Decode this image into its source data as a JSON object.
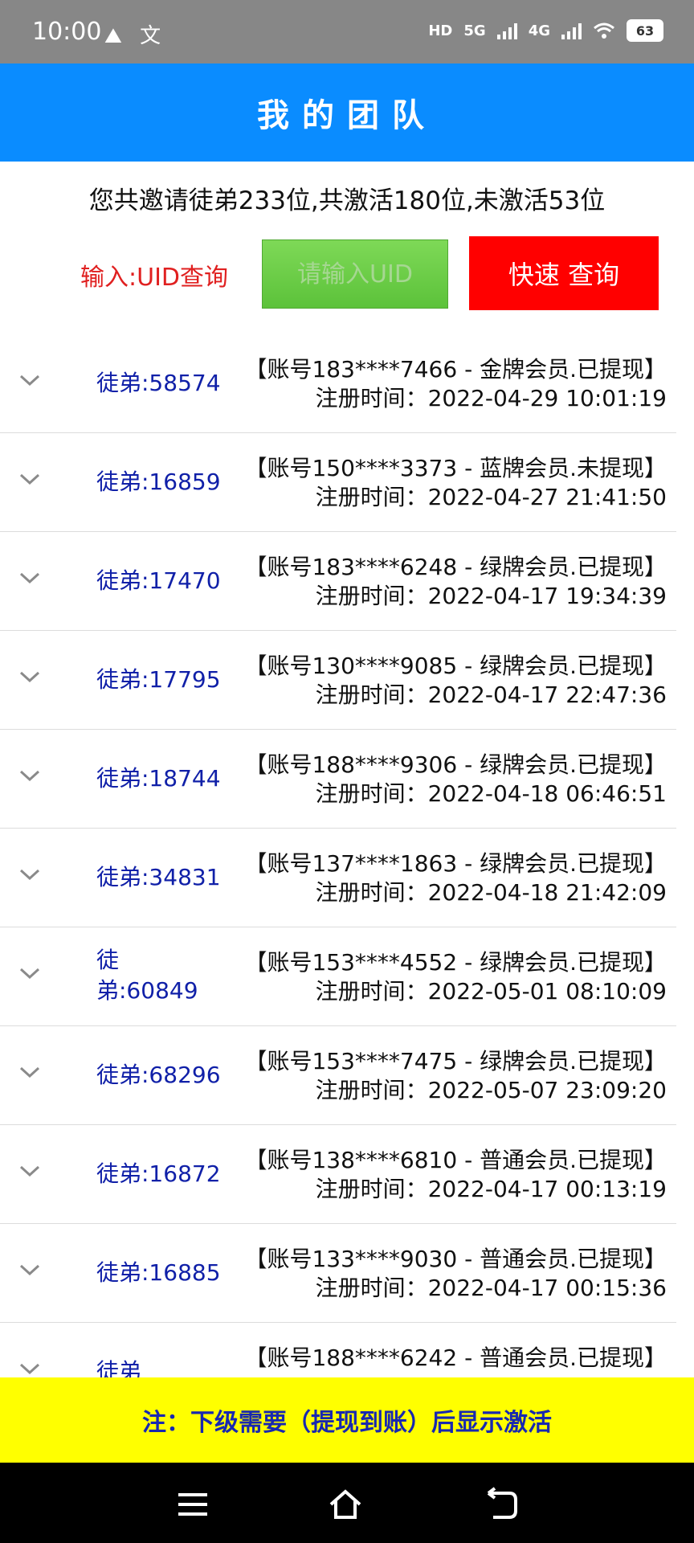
{
  "status": {
    "time": "10:00",
    "app_icons": [
      "mountain-app-icon",
      "text-app-icon"
    ],
    "indicators": {
      "hd": "HD",
      "net1": "5G",
      "net2": "4G",
      "battery": "63"
    }
  },
  "header": {
    "title": "我的团队"
  },
  "summary": "您共邀请徒弟233位,共激活180位,未激活53位",
  "query": {
    "label": "输入:UID查询",
    "placeholder": "请输入UID",
    "button": "快速 查询"
  },
  "members": [
    {
      "disciple": "徒弟:58574",
      "account": "【账号183****7466 - 金牌会员.已提现】",
      "reg": "注册时间：2022-04-29 10:01:19"
    },
    {
      "disciple": "徒弟:16859",
      "account": "【账号150****3373 - 蓝牌会员.未提现】",
      "reg": "注册时间：2022-04-27 21:41:50"
    },
    {
      "disciple": "徒弟:17470",
      "account": "【账号183****6248 - 绿牌会员.已提现】",
      "reg": "注册时间：2022-04-17 19:34:39"
    },
    {
      "disciple": "徒弟:17795",
      "account": "【账号130****9085 - 绿牌会员.已提现】",
      "reg": "注册时间：2022-04-17 22:47:36"
    },
    {
      "disciple": "徒弟:18744",
      "account": "【账号188****9306 - 绿牌会员.已提现】",
      "reg": "注册时间：2022-04-18 06:46:51"
    },
    {
      "disciple": "徒弟:34831",
      "account": "【账号137****1863 - 绿牌会员.已提现】",
      "reg": "注册时间：2022-04-18 21:42:09"
    },
    {
      "disciple": "徒弟:60849",
      "account": "【账号153****4552 - 绿牌会员.已提现】",
      "reg": "注册时间：2022-05-01 08:10:09"
    },
    {
      "disciple": "徒弟:68296",
      "account": "【账号153****7475 - 绿牌会员.已提现】",
      "reg": "注册时间：2022-05-07 23:09:20"
    },
    {
      "disciple": "徒弟:16872",
      "account": "【账号138****6810 - 普通会员.已提现】",
      "reg": "注册时间：2022-04-17 00:13:19"
    },
    {
      "disciple": "徒弟:16885",
      "account": "【账号133****9030 - 普通会员.已提现】",
      "reg": "注册时间：2022-04-17 00:15:36"
    },
    {
      "disciple": "徒弟",
      "account": "【账号188****6242 - 普通会员.已提现】",
      "reg": ""
    }
  ],
  "note": "注：下级需要（提现到账）后显示激活",
  "colors": {
    "header": "#0a8cff",
    "button": "#ff0000",
    "input": "#6cd047",
    "note_bg": "#ffff00",
    "disciple_text": "#1020a8"
  }
}
